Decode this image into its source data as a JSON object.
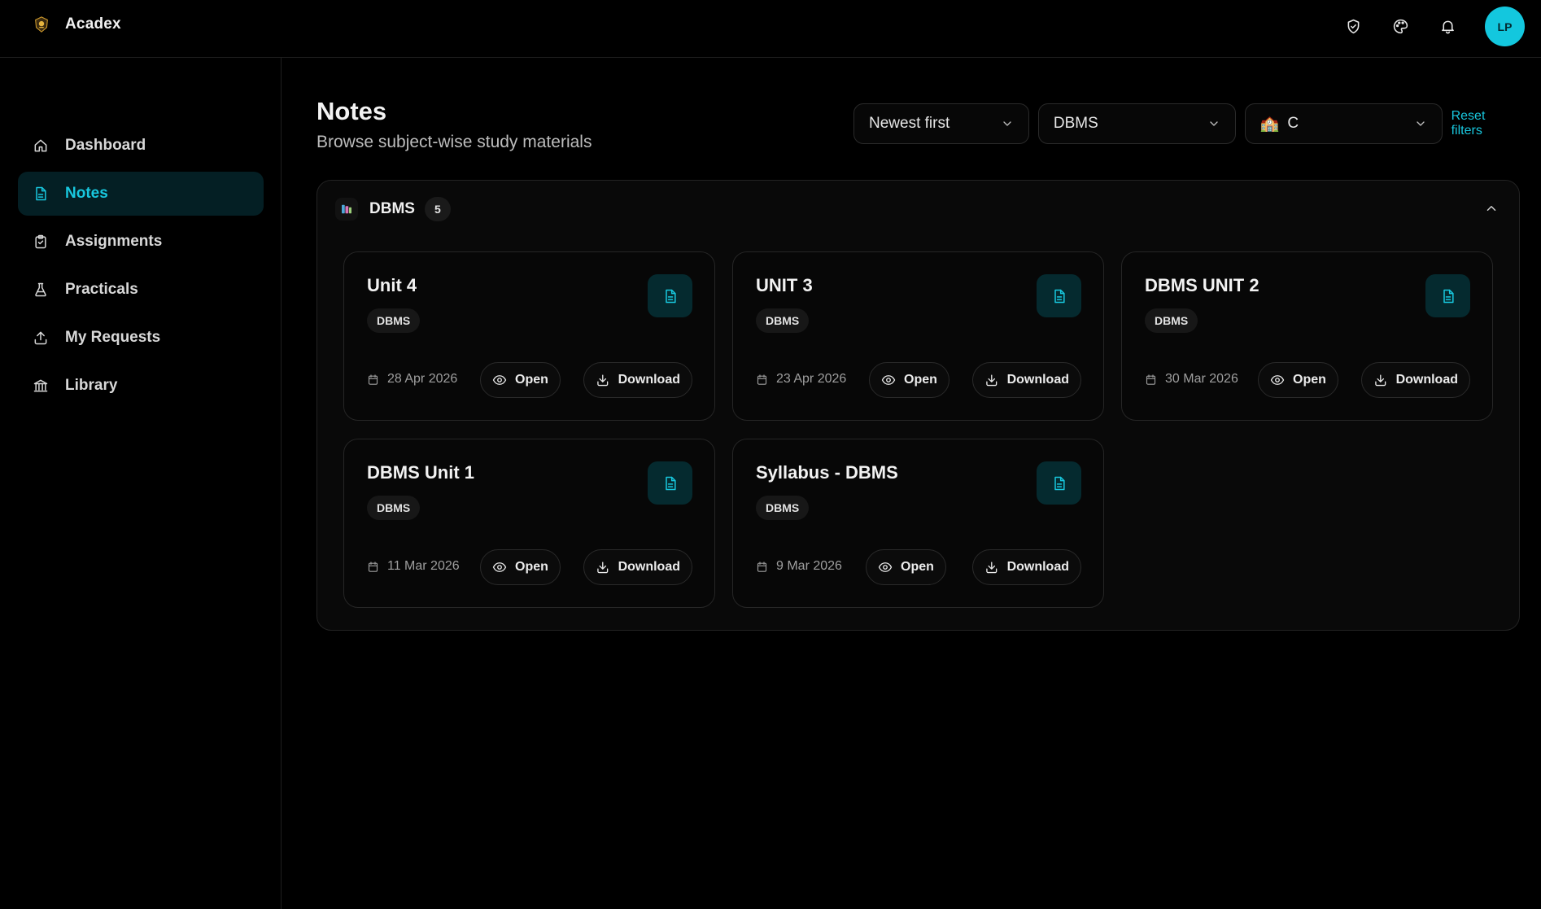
{
  "app": {
    "name": "Acadex",
    "avatar_initials": "LP",
    "accent": "#18c7de"
  },
  "topbar": {
    "icons": [
      "shield-check-icon",
      "palette-icon",
      "bell-icon"
    ]
  },
  "sidebar": {
    "items": [
      {
        "label": "Dashboard",
        "icon": "home-icon",
        "active": false
      },
      {
        "label": "Notes",
        "icon": "file-text-icon",
        "active": true
      },
      {
        "label": "Assignments",
        "icon": "clipboard-icon",
        "active": false
      },
      {
        "label": "Practicals",
        "icon": "flask-icon",
        "active": false
      },
      {
        "label": "My Requests",
        "icon": "upload-icon",
        "active": false
      },
      {
        "label": "Library",
        "icon": "library-icon",
        "active": false
      }
    ]
  },
  "page": {
    "title": "Notes",
    "subtitle": "Browse subject-wise study materials"
  },
  "filters": {
    "sort": "Newest first",
    "subject": "DBMS",
    "class_emoji": "🏫",
    "class": "C",
    "reset_label": "Reset filters"
  },
  "group": {
    "name": "DBMS",
    "count": "5",
    "notes": [
      {
        "title": "Unit 4",
        "tag": "DBMS",
        "date": "28 Apr 2026",
        "open_label": "Open",
        "download_label": "Download"
      },
      {
        "title": "UNIT 3",
        "tag": "DBMS",
        "date": "23 Apr 2026",
        "open_label": "Open",
        "download_label": "Download"
      },
      {
        "title": "DBMS UNIT 2",
        "tag": "DBMS",
        "date": "30 Mar 2026",
        "open_label": "Open",
        "download_label": "Download"
      },
      {
        "title": "DBMS Unit 1",
        "tag": "DBMS",
        "date": "11 Mar 2026",
        "open_label": "Open",
        "download_label": "Download"
      },
      {
        "title": "Syllabus - DBMS",
        "tag": "DBMS",
        "date": "9 Mar 2026",
        "open_label": "Open",
        "download_label": "Download"
      }
    ]
  }
}
